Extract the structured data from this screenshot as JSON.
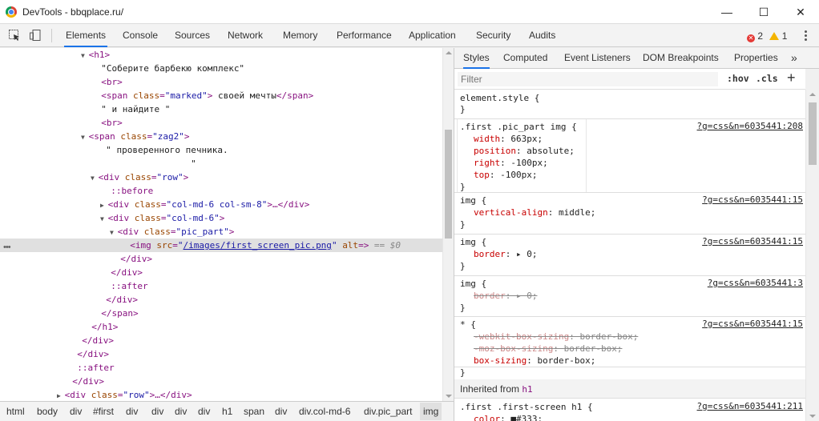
{
  "window": {
    "title": "DevTools - bbqplace.ru/",
    "minimize": "—",
    "maximize": "☐",
    "close": "✕"
  },
  "toolbar": {
    "tabs": [
      "Elements",
      "Console",
      "Sources",
      "Network",
      "Memory",
      "Performance",
      "Application",
      "Security",
      "Audits"
    ],
    "active_tab": "Elements",
    "errors": "2",
    "warnings": "1"
  },
  "dom": [
    {
      "indent": 0,
      "tri": "▼",
      "tag": "<h1>"
    },
    {
      "indent": 1,
      "text": "\"Соберите барбекю комплекс\""
    },
    {
      "indent": 1,
      "tag": "<br>"
    },
    {
      "indent": 1,
      "open": "<span",
      "attrs": [
        {
          "n": "class",
          "v": "\"marked\""
        }
      ],
      "close": ">",
      "text": " своей мечты",
      "end": "</span>"
    },
    {
      "indent": 1,
      "text": "\" и найдите \""
    },
    {
      "indent": 1,
      "tag": "<br>"
    },
    {
      "indent": 0,
      "tri": "▼",
      "open": "<span",
      "attrs": [
        {
          "n": "class",
          "v": "\"zag2\""
        }
      ],
      "close": ">"
    },
    {
      "indent": 1.5,
      "text": "\" проверенного печника."
    },
    {
      "indent": 1.5,
      "text": "                \""
    },
    {
      "indent": 1,
      "tri": "▼",
      "open": "<div",
      "attrs": [
        {
          "n": "class",
          "v": "\"row\""
        }
      ],
      "close": ">"
    },
    {
      "indent": 2,
      "pseudo": "::before"
    },
    {
      "indent": 2,
      "tri": "▶",
      "open": "<div",
      "attrs": [
        {
          "n": "class",
          "v": "\"col-md-6 col-sm-8\""
        }
      ],
      "close": ">…</div>"
    },
    {
      "indent": 2,
      "tri": "▼",
      "open": "<div",
      "attrs": [
        {
          "n": "class",
          "v": "\"col-md-6\""
        }
      ],
      "close": ">"
    },
    {
      "indent": 3,
      "tri": "▼",
      "open": "<div",
      "attrs": [
        {
          "n": "class",
          "v": "\"pic_part\""
        }
      ],
      "close": ">"
    },
    {
      "indent": 4,
      "selected": true,
      "open": "<img",
      "attrs": [
        {
          "n": "src",
          "v": "/images/first_screen_pic.png",
          "link": true
        },
        {
          "n": "alt",
          "v": ""
        }
      ],
      "close": ">",
      "suffix": " == $0"
    },
    {
      "indent": 3,
      "tag": "</div>"
    },
    {
      "indent": 2,
      "tag": "</div>"
    },
    {
      "indent": 2,
      "pseudo": "::after"
    },
    {
      "indent": 1.5,
      "tag": "</div>"
    },
    {
      "indent": 1,
      "tag": "</span>"
    },
    {
      "indent": 0,
      "tag": "</h1>"
    },
    {
      "indent": -1,
      "tag": "</div>"
    },
    {
      "indent": -1.5,
      "tag": "</div>"
    },
    {
      "indent": -1.5,
      "pseudo": "::after"
    },
    {
      "indent": -2,
      "tag": "</div>"
    },
    {
      "indent": -2.5,
      "tri": "▶",
      "open": "<div",
      "attrs": [
        {
          "n": "class",
          "v": "\"row\""
        }
      ],
      "close": ">…</div>"
    }
  ],
  "breadcrumbs": [
    "html",
    "body",
    "div",
    "#first",
    "div",
    "div",
    "div",
    "div",
    "h1",
    "span",
    "div",
    "div.col-md-6",
    "div.pic_part",
    "img"
  ],
  "side_tabs": [
    "Styles",
    "Computed",
    "Event Listeners",
    "DOM Breakpoints",
    "Properties",
    "»"
  ],
  "active_side_tab": "Styles",
  "filter": {
    "placeholder": "Filter",
    "hov": ":hov",
    "cls": ".cls",
    "add": "+"
  },
  "rules": [
    {
      "selector": "element.style {",
      "source": "",
      "decls": [],
      "closing": "}"
    },
    {
      "selector": ".first .pic_part img {",
      "source": "?g=css&n=6035441:208",
      "decls": [
        {
          "p": "width",
          "v": "663px;"
        },
        {
          "p": "position",
          "v": "absolute;"
        },
        {
          "p": "right",
          "v": "-100px;"
        },
        {
          "p": "top",
          "v": "-100px;"
        }
      ],
      "closing": "}"
    },
    {
      "selector": "img {",
      "source": "?g=css&n=6035441:15",
      "decls": [
        {
          "p": "vertical-align",
          "v": "middle;"
        }
      ],
      "closing": "}"
    },
    {
      "selector": "img {",
      "source": "?g=css&n=6035441:15",
      "decls": [
        {
          "p": "border",
          "v": "▸ 0;"
        }
      ],
      "closing": "}"
    },
    {
      "selector": "img {",
      "source": "?g=css&n=6035441:3",
      "decls": [
        {
          "p": "border",
          "v": "▸ 0;",
          "struck": true
        }
      ],
      "closing": "}"
    },
    {
      "selector": "* {",
      "source": "?g=css&n=6035441:15",
      "decls": [
        {
          "p": "-webkit-box-sizing",
          "v": "border-box;",
          "struck": true
        },
        {
          "p": "-moz-box-sizing",
          "v": "border-box;",
          "struck": true
        },
        {
          "p": "box-sizing",
          "v": "border-box;"
        }
      ],
      "closing": "}"
    }
  ],
  "inherited": {
    "label": "Inherited from",
    "element": "h1"
  },
  "last_rule": {
    "selector": ".first .first-screen h1 {",
    "source": "?g=css&n=6035441:211",
    "decl_p": "color",
    "decl_v": "■#333;"
  }
}
